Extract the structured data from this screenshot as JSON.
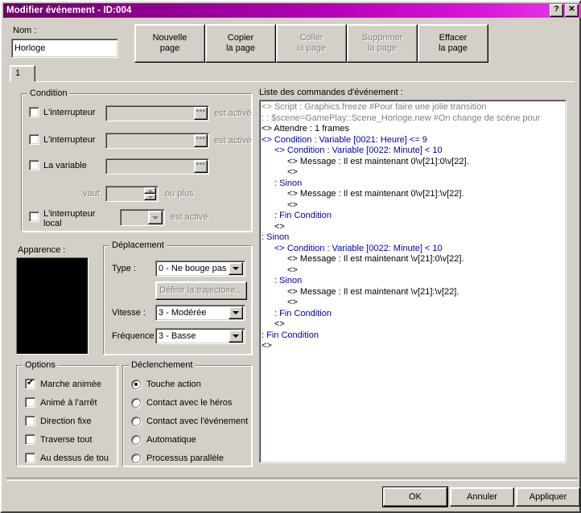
{
  "window": {
    "title": "Modifier événement - ID:004",
    "help_btn": "?",
    "close_btn": "✕",
    "titlebar_color_left": "#6c006c",
    "titlebar_color_right": "#e83ce8"
  },
  "name_section": {
    "label": "Nom :",
    "value": "Horloge"
  },
  "page_buttons": [
    {
      "line1": "Nouvelle",
      "line2": "page",
      "disabled": false
    },
    {
      "line1": "Copier",
      "line2": "la page",
      "disabled": false
    },
    {
      "line1": "Coller",
      "line2": "la page",
      "disabled": true
    },
    {
      "line1": "Supprimer",
      "line2": "la page",
      "disabled": true
    },
    {
      "line1": "Effacer",
      "line2": "la page",
      "disabled": false
    }
  ],
  "tabs": [
    {
      "label": "1",
      "selected": true
    }
  ],
  "condition_group": {
    "title": "Condition",
    "rows": [
      {
        "label": "L'interrupteur",
        "checked": false,
        "value": "",
        "suffix": "est activé"
      },
      {
        "label": "L'interrupteur",
        "checked": false,
        "value": "",
        "suffix": "est activé"
      },
      {
        "label": "La variable",
        "checked": false,
        "value": "",
        "suffix": ""
      },
      {
        "label": "vaut",
        "checked": false,
        "value": "",
        "suffix": "ou plus"
      },
      {
        "label": "L'interrupteur local",
        "checked": false,
        "value": "",
        "suffix": "est activé"
      }
    ]
  },
  "apparence": {
    "label": "Apparence :",
    "preview_color": "#000000"
  },
  "deplacement_group": {
    "title": "Déplacement",
    "type_label": "Type :",
    "type_value": "0 - Ne bouge pas",
    "trajectory_button": "Définir la trajectoire...",
    "vitesse_label": "Vitesse :",
    "vitesse_value": "3 - Modérée",
    "frequence_label": "Fréquence :",
    "frequence_value": "3 - Basse"
  },
  "options_group": {
    "title": "Options",
    "items": [
      {
        "label": "Marche animée",
        "checked": true
      },
      {
        "label": "Animé à l'arrêt",
        "checked": false
      },
      {
        "label": "Direction fixe",
        "checked": false
      },
      {
        "label": "Traverse tout",
        "checked": false
      },
      {
        "label": "Au dessus de tou",
        "checked": false
      }
    ]
  },
  "declenchement_group": {
    "title": "Déclenchement",
    "items": [
      {
        "label": "Touche action",
        "selected": true
      },
      {
        "label": "Contact avec le héros",
        "selected": false
      },
      {
        "label": "Contact avec l'événement",
        "selected": false
      },
      {
        "label": "Automatique",
        "selected": false
      },
      {
        "label": "Processus parallèle",
        "selected": false
      }
    ]
  },
  "command_list": {
    "title": "Liste des commandes d'événement :",
    "lines": [
      {
        "indent": 0,
        "marker": "<>",
        "text": "Script : Graphics.freeze #Pour faire une jolie transition",
        "color": "gray"
      },
      {
        "indent": 0,
        "marker": ":",
        "text": "        : $scene=GamePlay::Scene_Horloge.new #On change de scène pour",
        "color": "gray"
      },
      {
        "indent": 0,
        "marker": "<>",
        "text": "Attendre : 1 frames",
        "color": "black"
      },
      {
        "indent": 0,
        "marker": "<>",
        "text": "Condition : Variable [0021: Heure] <= 9",
        "color": "blue"
      },
      {
        "indent": 1,
        "marker": "<>",
        "text": "Condition : Variable [0022: Minute] < 10",
        "color": "blue"
      },
      {
        "indent": 2,
        "marker": "<>",
        "text": "Message : Il est maintenant 0\\v[21]:0\\v[22].",
        "color": "black"
      },
      {
        "indent": 2,
        "marker": "<>",
        "text": "",
        "color": "black"
      },
      {
        "indent": 1,
        "marker": ":",
        "text": "Sinon",
        "color": "blue"
      },
      {
        "indent": 2,
        "marker": "<>",
        "text": "Message : Il est maintenant 0\\v[21]:\\v[22].",
        "color": "black"
      },
      {
        "indent": 2,
        "marker": "<>",
        "text": "",
        "color": "black"
      },
      {
        "indent": 1,
        "marker": ":",
        "text": "Fin Condition",
        "color": "blue"
      },
      {
        "indent": 1,
        "marker": "<>",
        "text": "",
        "color": "black"
      },
      {
        "indent": 0,
        "marker": ":",
        "text": "Sinon",
        "color": "blue"
      },
      {
        "indent": 1,
        "marker": "<>",
        "text": "Condition : Variable [0022: Minute] < 10",
        "color": "blue"
      },
      {
        "indent": 2,
        "marker": "<>",
        "text": "Message : Il est maintenant \\v[21]:0\\v[22].",
        "color": "black"
      },
      {
        "indent": 2,
        "marker": "<>",
        "text": "",
        "color": "black"
      },
      {
        "indent": 1,
        "marker": ":",
        "text": "Sinon",
        "color": "blue"
      },
      {
        "indent": 2,
        "marker": "<>",
        "text": "Message : Il est maintenant \\v[21]:\\v[22].",
        "color": "black"
      },
      {
        "indent": 2,
        "marker": "<>",
        "text": "",
        "color": "black"
      },
      {
        "indent": 1,
        "marker": ":",
        "text": "Fin Condition",
        "color": "blue"
      },
      {
        "indent": 1,
        "marker": "<>",
        "text": "",
        "color": "black"
      },
      {
        "indent": 0,
        "marker": ":",
        "text": "Fin Condition",
        "color": "blue"
      },
      {
        "indent": 0,
        "marker": "<>",
        "text": "",
        "color": "black"
      }
    ]
  },
  "footer_buttons": [
    {
      "label": "OK",
      "default": true
    },
    {
      "label": "Annuler",
      "default": false
    },
    {
      "label": "Appliquer",
      "default": false
    }
  ]
}
